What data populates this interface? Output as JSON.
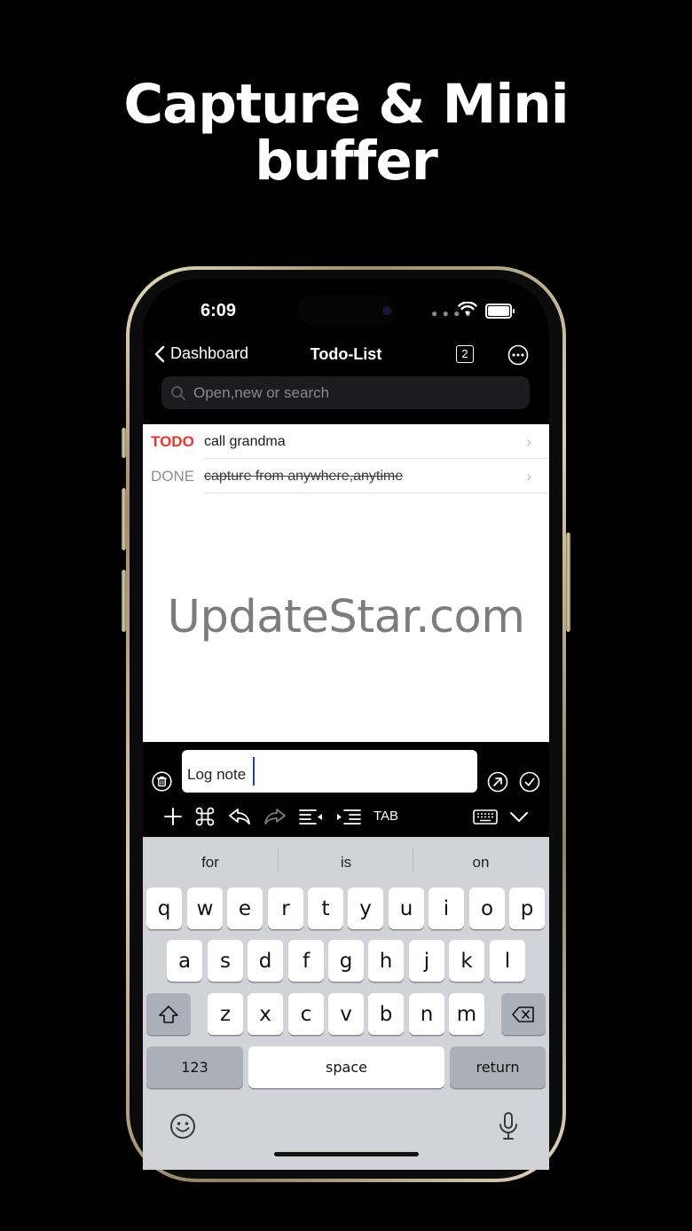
{
  "headline": {
    "line1": "Capture & Mini",
    "line2": "buffer"
  },
  "status": {
    "time": "6:09"
  },
  "nav": {
    "back_label": "Dashboard",
    "title": "Todo-List",
    "tab_count": "2"
  },
  "search": {
    "placeholder": "Open,new or search"
  },
  "items": [
    {
      "keyword": "TODO",
      "text": "call grandma",
      "state": "todo"
    },
    {
      "keyword": "DONE",
      "text": "capture from anywhere,anytime",
      "state": "done"
    }
  ],
  "watermark": "UpdateStar.com",
  "capture": {
    "value": "Log note"
  },
  "toolbar": {
    "tab_label": "TAB"
  },
  "keyboard": {
    "suggestions": [
      "for",
      "is",
      "on"
    ],
    "row1": [
      "q",
      "w",
      "e",
      "r",
      "t",
      "y",
      "u",
      "i",
      "o",
      "p"
    ],
    "row2": [
      "a",
      "s",
      "d",
      "f",
      "g",
      "h",
      "j",
      "k",
      "l"
    ],
    "row3": [
      "z",
      "x",
      "c",
      "v",
      "b",
      "n",
      "m"
    ],
    "numbers_label": "123",
    "space_label": "space",
    "return_label": "return"
  },
  "colors": {
    "todo": "#e8352e",
    "done": "#8e8e93",
    "accent": "#1a3bd6"
  }
}
